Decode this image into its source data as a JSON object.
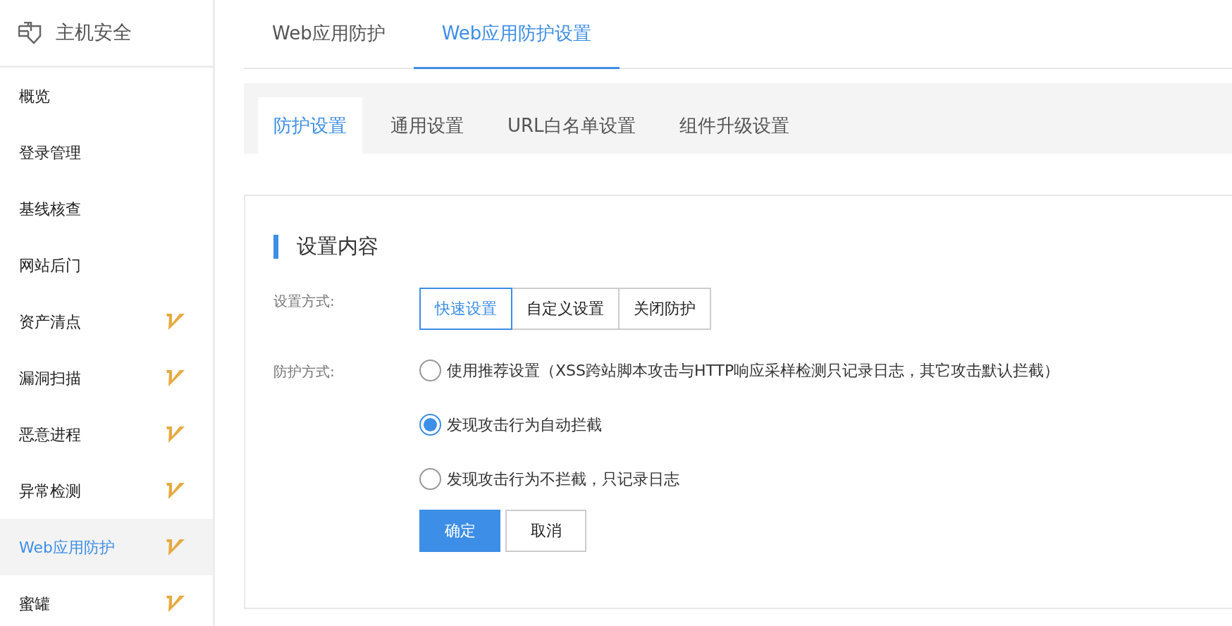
{
  "sidebar": {
    "title": "主机安全",
    "items": [
      {
        "label": "概览",
        "selected": false,
        "vip": false
      },
      {
        "label": "登录管理",
        "selected": false,
        "vip": false
      },
      {
        "label": "基线核查",
        "selected": false,
        "vip": false
      },
      {
        "label": "网站后门",
        "selected": false,
        "vip": false
      },
      {
        "label": "资产清点",
        "selected": false,
        "vip": true
      },
      {
        "label": "漏洞扫描",
        "selected": false,
        "vip": true
      },
      {
        "label": "恶意进程",
        "selected": false,
        "vip": true
      },
      {
        "label": "异常检测",
        "selected": false,
        "vip": true
      },
      {
        "label": "Web应用防护",
        "selected": true,
        "vip": true
      },
      {
        "label": "蜜罐",
        "selected": false,
        "vip": true
      }
    ]
  },
  "tabs": [
    {
      "label": "Web应用防护",
      "selected": false
    },
    {
      "label": "Web应用防护设置",
      "selected": true
    }
  ],
  "subtabs": [
    {
      "label": "防护设置",
      "selected": true
    },
    {
      "label": "通用设置",
      "selected": false
    },
    {
      "label": "URL白名单设置",
      "selected": false
    },
    {
      "label": "组件升级设置",
      "selected": false
    }
  ],
  "section_title": "设置内容",
  "setting_mode": {
    "label": "设置方式:",
    "options": [
      {
        "label": "快速设置",
        "selected": true
      },
      {
        "label": "自定义设置",
        "selected": false
      },
      {
        "label": "关闭防护",
        "selected": false
      }
    ]
  },
  "protection_mode": {
    "label": "防护方式:",
    "options": [
      {
        "label": "使用推荐设置（XSS跨站脚本攻击与HTTP响应采样检测只记录日志，其它攻击默认拦截）",
        "selected": false
      },
      {
        "label": "发现攻击行为自动拦截",
        "selected": true
      },
      {
        "label": "发现攻击行为不拦截，只记录日志",
        "selected": false
      }
    ]
  },
  "buttons": [
    {
      "label": "确定",
      "kind": "primary"
    },
    {
      "label": "取消",
      "kind": "secondary"
    }
  ]
}
